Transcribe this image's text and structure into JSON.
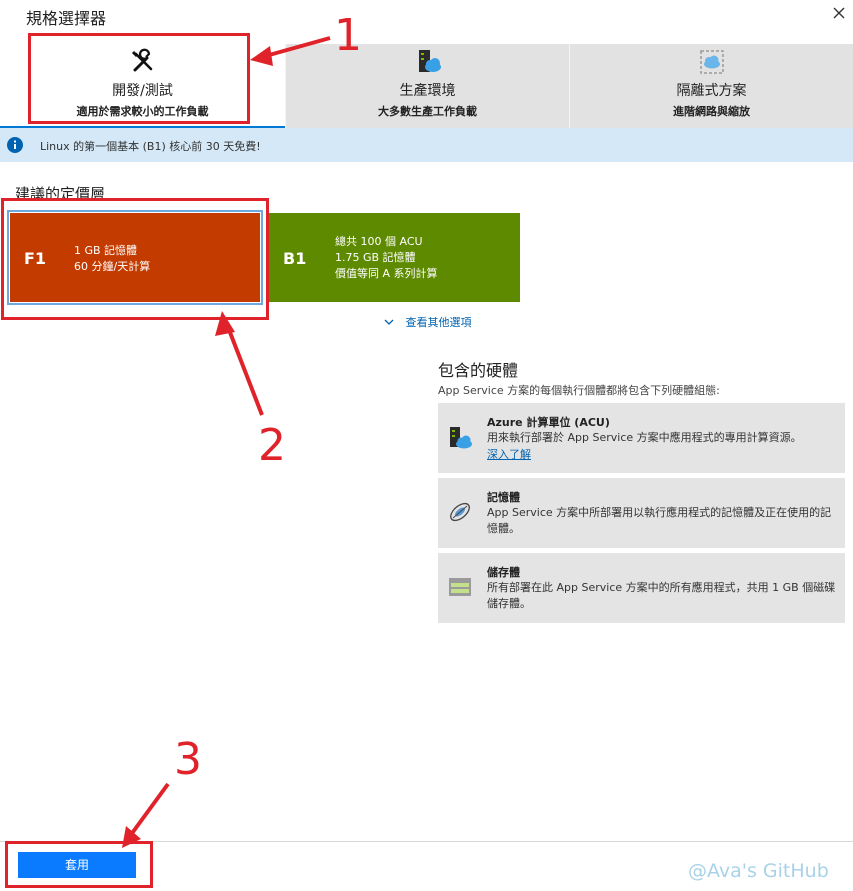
{
  "header": {
    "title": "規格選擇器",
    "close_icon": "close-icon"
  },
  "tabs": [
    {
      "label": "開發/測試",
      "sub": "適用於需求較小的工作負載",
      "icon": "wrench-screwdriver-icon",
      "active": true
    },
    {
      "label": "生產環境",
      "sub": "大多數生產工作負載",
      "icon": "server-cloud-icon",
      "active": false
    },
    {
      "label": "隔離式方案",
      "sub": "進階網路與縮放",
      "icon": "isolated-network-icon",
      "active": false
    }
  ],
  "infobar": {
    "text": "Linux 的第一個基本 (B1) 核心前 30 天免費!",
    "icon": "info-icon"
  },
  "recommended": {
    "title": "建議的定價層",
    "tiers": [
      {
        "code": "F1",
        "lines": [
          "1 GB 記憶體",
          "60 分鐘/天計算"
        ],
        "color": "#c43b00"
      },
      {
        "code": "B1",
        "lines": [
          "總共 100 個 ACU",
          "1.75 GB 記憶體",
          "價值等同 A 系列計算"
        ],
        "color": "#5e8a00"
      }
    ],
    "more_options": "查看其他選項"
  },
  "hardware": {
    "title": "包含的硬體",
    "subtitle": "App Service 方案的每個執行個體都將包含下列硬體組態:",
    "items": [
      {
        "name": "Azure 計算單位 (ACU)",
        "desc": "用來執行部署於 App Service 方案中應用程式的專用計算資源。",
        "link": "深入了解",
        "icon": "compute-icon"
      },
      {
        "name": "記憶體",
        "desc": "App Service 方案中所部署用以執行應用程式的記憶體及正在使用的記憶體。",
        "icon": "memory-icon"
      },
      {
        "name": "儲存體",
        "desc": "所有部署在此 App Service 方案中的所有應用程式，共用 1 GB 個磁碟儲存體。",
        "icon": "storage-icon"
      }
    ]
  },
  "footer": {
    "apply_label": "套用"
  },
  "annotations": {
    "n1": "1",
    "n2": "2",
    "n3": "3",
    "color": "#e0232b"
  },
  "watermark": "@Ava's GitHub"
}
